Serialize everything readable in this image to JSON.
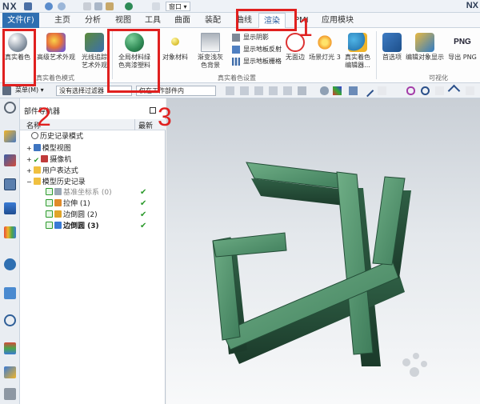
{
  "titlebar": {
    "logo": "NX",
    "logo_right": "NX",
    "window_menu": "窗口 ▾"
  },
  "tabs": [
    {
      "label": "文件(F)"
    },
    {
      "label": "主页"
    },
    {
      "label": "分析"
    },
    {
      "label": "视图"
    },
    {
      "label": "工具"
    },
    {
      "label": "曲面"
    },
    {
      "label": "装配"
    },
    {
      "label": "曲线"
    },
    {
      "label": "渲染"
    },
    {
      "label": "PMI"
    },
    {
      "label": "应用模块"
    }
  ],
  "ribbon": {
    "true_shading": "真实着色",
    "advanced_art": "高级艺术外观",
    "ray_trace": [
      "光线追踪",
      "艺术外观"
    ],
    "global_material": [
      "全局材料绿",
      "色亮漆塑料"
    ],
    "object_material": "对象材料",
    "gradient_bg": [
      "渐变浅灰",
      "色背景"
    ],
    "show_shadow": "显示阴影",
    "show_floor_reflect": "显示地板反射",
    "show_floor_grid": "显示地板栅格",
    "no_edges": "无面边",
    "scene_light": "场景灯光 3",
    "true_shading_editor": [
      "真实着色",
      "编辑器..."
    ],
    "preferences": "首选项",
    "edit_object_display": "编辑对象显示",
    "export_png": "导出 PNG",
    "png_label": "PNG",
    "group_true_shading": "真实着色模式",
    "group_true_shading_settings": "真实着色设置",
    "group_visualization": "可视化"
  },
  "toolbar2": {
    "menu": "菜单(M) ▾",
    "filter": "没有选择过滤器",
    "scope": "仅在工作部件内"
  },
  "navigator": {
    "title": "部件导航器",
    "col_name": "名称",
    "col_latest": "最新",
    "rows": [
      {
        "label": "历史记录模式",
        "check": ""
      },
      {
        "label": "模型视图",
        "check": ""
      },
      {
        "label": "摄像机",
        "check": ""
      },
      {
        "label": "用户表达式",
        "check": ""
      },
      {
        "label": "模型历史记录",
        "check": ""
      },
      {
        "label": "基准坐标系 (0)",
        "check": "✔"
      },
      {
        "label": "拉伸 (1)",
        "check": "✔"
      },
      {
        "label": "边倒圆 (2)",
        "check": "✔"
      },
      {
        "label": "边倒圆 (3)",
        "check": "✔"
      }
    ]
  },
  "annotations": {
    "n1": "1",
    "n2": "2",
    "n3": "3"
  },
  "colors": {
    "file_tab": "#2f6fb1",
    "annotation": "#e0201f",
    "model_green": "#3f7d5b"
  }
}
